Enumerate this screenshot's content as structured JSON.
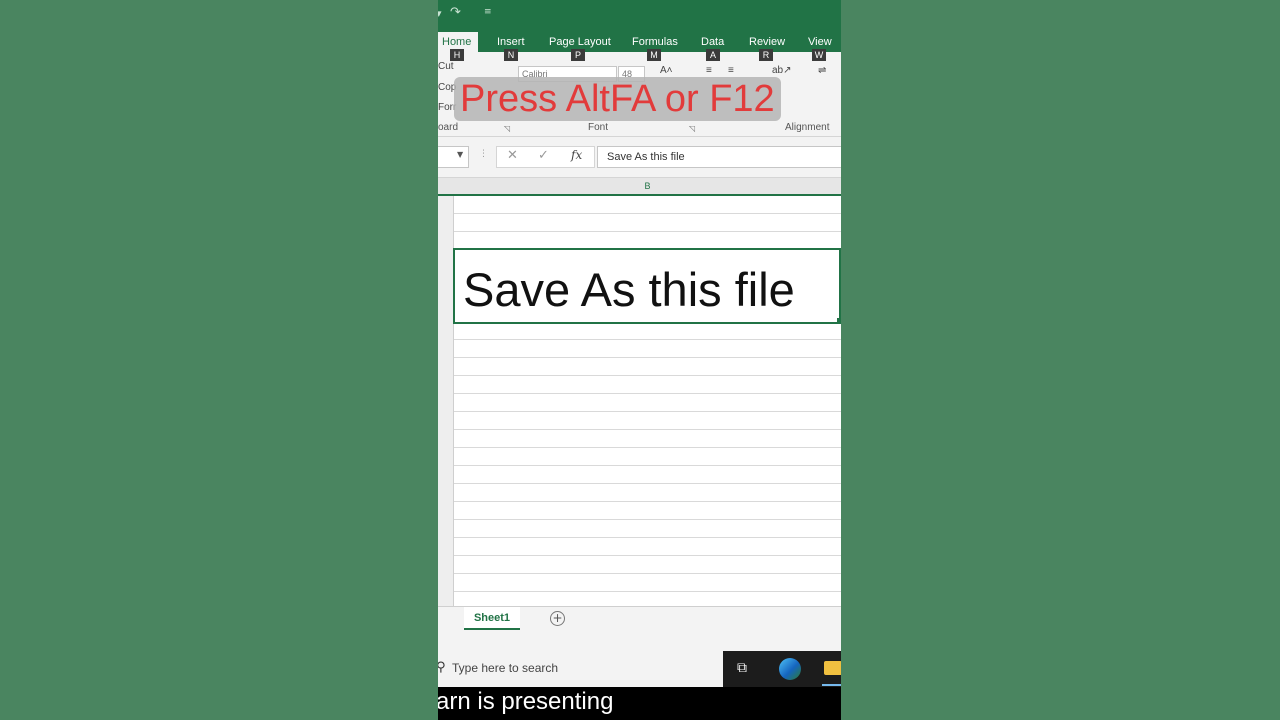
{
  "colors": {
    "excel_green": "#217346",
    "background_green": "#4a8560",
    "caption_red": "#e23b3b"
  },
  "ribbon": {
    "tabs": [
      {
        "label": "Home",
        "keytip": "H"
      },
      {
        "label": "Insert",
        "keytip": "N"
      },
      {
        "label": "Page Layout",
        "keytip": "P"
      },
      {
        "label": "Formulas",
        "keytip": "M"
      },
      {
        "label": "Data",
        "keytip": "A"
      },
      {
        "label": "Review",
        "keytip": "R"
      },
      {
        "label": "View",
        "keytip": "W"
      }
    ],
    "clipboard": {
      "cut": "Cut",
      "copy": "Cop",
      "format": "Forr",
      "group_label": "oard"
    },
    "font": {
      "family": "Calibri",
      "size": "48",
      "group_label": "Font"
    },
    "alignment": {
      "group_label": "Alignment"
    }
  },
  "overlay": {
    "text": "Press AltFA or F12"
  },
  "formula_bar": {
    "cancel_icon": "✕",
    "enter_icon": "✓",
    "fx_label": "fx",
    "content": "Save As this file"
  },
  "grid": {
    "column_header": "B",
    "active_cell_text": "Save As this file"
  },
  "sheets": {
    "active": "Sheet1",
    "add_icon": "+"
  },
  "taskbar": {
    "search_placeholder": "Type here to search"
  },
  "caption": {
    "text": "arn is presenting"
  }
}
